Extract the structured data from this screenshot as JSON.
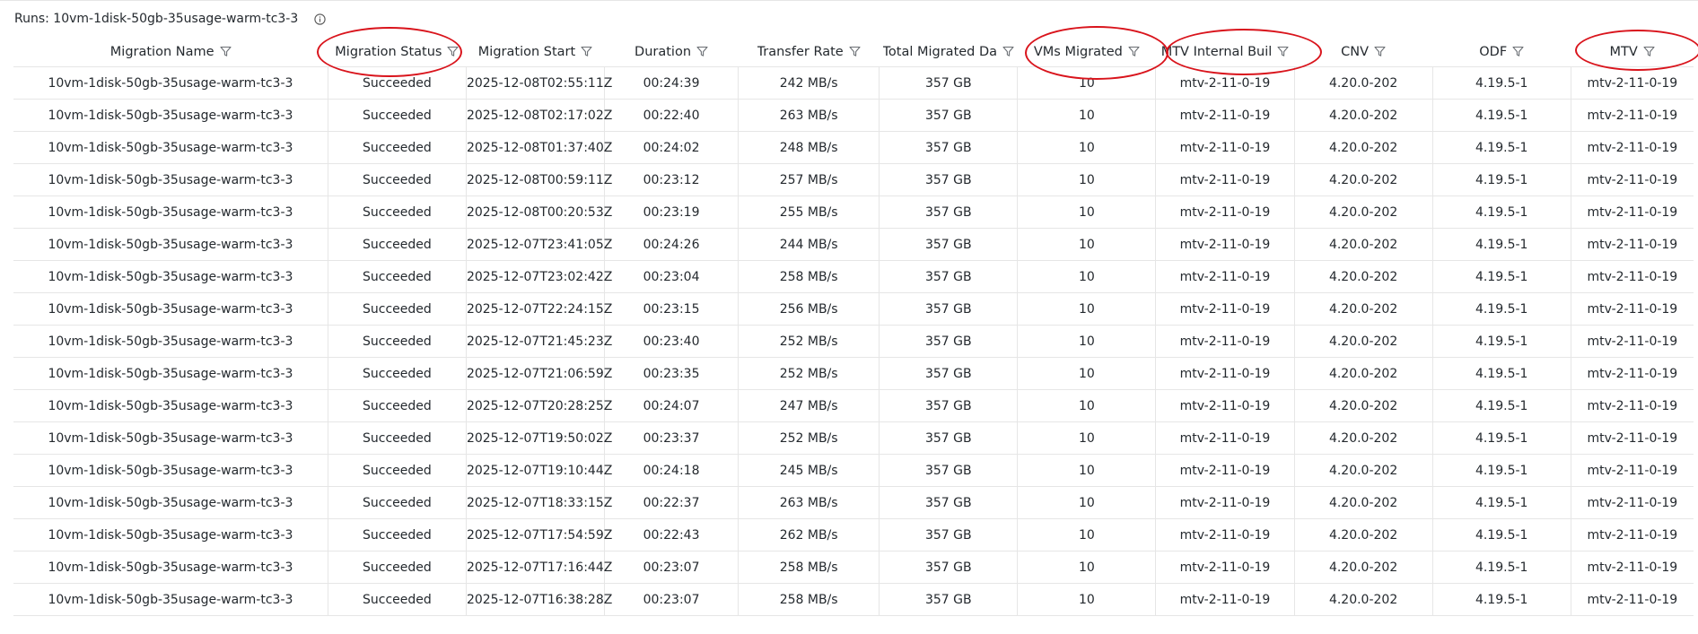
{
  "panel": {
    "title": "Runs: 10vm-1disk-50gb-35usage-warm-tc3-3"
  },
  "table": {
    "columns": [
      {
        "label": "Migration Name",
        "highlighted": false
      },
      {
        "label": "Migration Status",
        "highlighted": true
      },
      {
        "label": "Migration Start",
        "highlighted": false
      },
      {
        "label": "Duration",
        "highlighted": false
      },
      {
        "label": "Transfer Rate",
        "highlighted": false
      },
      {
        "label": "Total Migrated Da",
        "highlighted": false
      },
      {
        "label": "VMs Migrated",
        "highlighted": true
      },
      {
        "label": "MTV Internal Buil",
        "highlighted": true
      },
      {
        "label": "CNV",
        "highlighted": false
      },
      {
        "label": "ODF",
        "highlighted": false
      },
      {
        "label": "MTV",
        "highlighted": true
      }
    ],
    "rows": [
      [
        "10vm-1disk-50gb-35usage-warm-tc3-3",
        "Succeeded",
        "2025-12-08T02:55:11Z",
        "00:24:39",
        "242 MB/s",
        "357 GB",
        "10",
        "mtv-2-11-0-19",
        "4.20.0-202",
        "4.19.5-1",
        "mtv-2-11-0-19"
      ],
      [
        "10vm-1disk-50gb-35usage-warm-tc3-3",
        "Succeeded",
        "2025-12-08T02:17:02Z",
        "00:22:40",
        "263 MB/s",
        "357 GB",
        "10",
        "mtv-2-11-0-19",
        "4.20.0-202",
        "4.19.5-1",
        "mtv-2-11-0-19"
      ],
      [
        "10vm-1disk-50gb-35usage-warm-tc3-3",
        "Succeeded",
        "2025-12-08T01:37:40Z",
        "00:24:02",
        "248 MB/s",
        "357 GB",
        "10",
        "mtv-2-11-0-19",
        "4.20.0-202",
        "4.19.5-1",
        "mtv-2-11-0-19"
      ],
      [
        "10vm-1disk-50gb-35usage-warm-tc3-3",
        "Succeeded",
        "2025-12-08T00:59:11Z",
        "00:23:12",
        "257 MB/s",
        "357 GB",
        "10",
        "mtv-2-11-0-19",
        "4.20.0-202",
        "4.19.5-1",
        "mtv-2-11-0-19"
      ],
      [
        "10vm-1disk-50gb-35usage-warm-tc3-3",
        "Succeeded",
        "2025-12-08T00:20:53Z",
        "00:23:19",
        "255 MB/s",
        "357 GB",
        "10",
        "mtv-2-11-0-19",
        "4.20.0-202",
        "4.19.5-1",
        "mtv-2-11-0-19"
      ],
      [
        "10vm-1disk-50gb-35usage-warm-tc3-3",
        "Succeeded",
        "2025-12-07T23:41:05Z",
        "00:24:26",
        "244 MB/s",
        "357 GB",
        "10",
        "mtv-2-11-0-19",
        "4.20.0-202",
        "4.19.5-1",
        "mtv-2-11-0-19"
      ],
      [
        "10vm-1disk-50gb-35usage-warm-tc3-3",
        "Succeeded",
        "2025-12-07T23:02:42Z",
        "00:23:04",
        "258 MB/s",
        "357 GB",
        "10",
        "mtv-2-11-0-19",
        "4.20.0-202",
        "4.19.5-1",
        "mtv-2-11-0-19"
      ],
      [
        "10vm-1disk-50gb-35usage-warm-tc3-3",
        "Succeeded",
        "2025-12-07T22:24:15Z",
        "00:23:15",
        "256 MB/s",
        "357 GB",
        "10",
        "mtv-2-11-0-19",
        "4.20.0-202",
        "4.19.5-1",
        "mtv-2-11-0-19"
      ],
      [
        "10vm-1disk-50gb-35usage-warm-tc3-3",
        "Succeeded",
        "2025-12-07T21:45:23Z",
        "00:23:40",
        "252 MB/s",
        "357 GB",
        "10",
        "mtv-2-11-0-19",
        "4.20.0-202",
        "4.19.5-1",
        "mtv-2-11-0-19"
      ],
      [
        "10vm-1disk-50gb-35usage-warm-tc3-3",
        "Succeeded",
        "2025-12-07T21:06:59Z",
        "00:23:35",
        "252 MB/s",
        "357 GB",
        "10",
        "mtv-2-11-0-19",
        "4.20.0-202",
        "4.19.5-1",
        "mtv-2-11-0-19"
      ],
      [
        "10vm-1disk-50gb-35usage-warm-tc3-3",
        "Succeeded",
        "2025-12-07T20:28:25Z",
        "00:24:07",
        "247 MB/s",
        "357 GB",
        "10",
        "mtv-2-11-0-19",
        "4.20.0-202",
        "4.19.5-1",
        "mtv-2-11-0-19"
      ],
      [
        "10vm-1disk-50gb-35usage-warm-tc3-3",
        "Succeeded",
        "2025-12-07T19:50:02Z",
        "00:23:37",
        "252 MB/s",
        "357 GB",
        "10",
        "mtv-2-11-0-19",
        "4.20.0-202",
        "4.19.5-1",
        "mtv-2-11-0-19"
      ],
      [
        "10vm-1disk-50gb-35usage-warm-tc3-3",
        "Succeeded",
        "2025-12-07T19:10:44Z",
        "00:24:18",
        "245 MB/s",
        "357 GB",
        "10",
        "mtv-2-11-0-19",
        "4.20.0-202",
        "4.19.5-1",
        "mtv-2-11-0-19"
      ],
      [
        "10vm-1disk-50gb-35usage-warm-tc3-3",
        "Succeeded",
        "2025-12-07T18:33:15Z",
        "00:22:37",
        "263 MB/s",
        "357 GB",
        "10",
        "mtv-2-11-0-19",
        "4.20.0-202",
        "4.19.5-1",
        "mtv-2-11-0-19"
      ],
      [
        "10vm-1disk-50gb-35usage-warm-tc3-3",
        "Succeeded",
        "2025-12-07T17:54:59Z",
        "00:22:43",
        "262 MB/s",
        "357 GB",
        "10",
        "mtv-2-11-0-19",
        "4.20.0-202",
        "4.19.5-1",
        "mtv-2-11-0-19"
      ],
      [
        "10vm-1disk-50gb-35usage-warm-tc3-3",
        "Succeeded",
        "2025-12-07T17:16:44Z",
        "00:23:07",
        "258 MB/s",
        "357 GB",
        "10",
        "mtv-2-11-0-19",
        "4.20.0-202",
        "4.19.5-1",
        "mtv-2-11-0-19"
      ],
      [
        "10vm-1disk-50gb-35usage-warm-tc3-3",
        "Succeeded",
        "2025-12-07T16:38:28Z",
        "00:23:07",
        "258 MB/s",
        "357 GB",
        "10",
        "mtv-2-11-0-19",
        "4.20.0-202",
        "4.19.5-1",
        "mtv-2-11-0-19"
      ]
    ]
  },
  "icons": {
    "info": "info-circle-icon",
    "filter": "filter-funnel-icon"
  },
  "colors": {
    "highlight": "#d9141c",
    "grid": "#e6e6e6",
    "text": "#24292e"
  }
}
